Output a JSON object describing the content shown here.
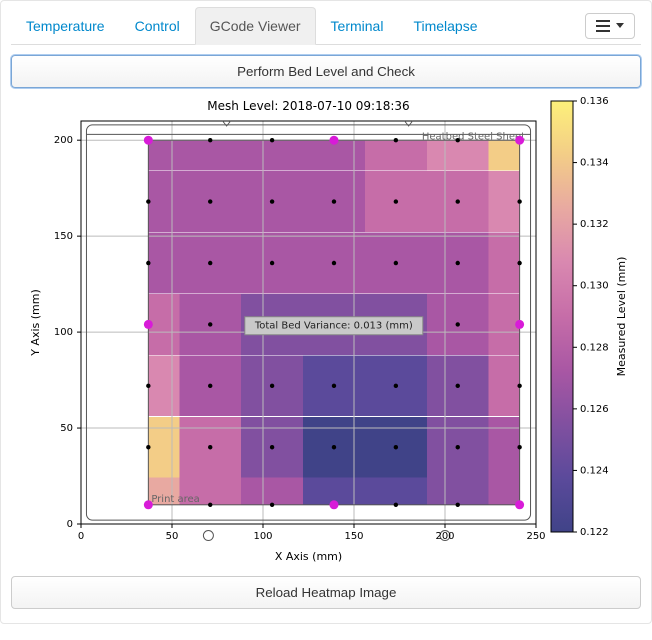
{
  "tabs": {
    "items": [
      {
        "label": "Temperature",
        "active": false
      },
      {
        "label": "Control",
        "active": false
      },
      {
        "label": "GCode Viewer",
        "active": true
      },
      {
        "label": "Terminal",
        "active": false
      },
      {
        "label": "Timelapse",
        "active": false
      }
    ]
  },
  "buttons": {
    "perform": "Perform Bed Level and Check",
    "reload": "Reload Heatmap Image"
  },
  "plot": {
    "title": "Mesh Level: 2018-07-10 09:18:36",
    "xlabel": "X Axis (mm)",
    "ylabel": "Y Axis (mm)",
    "cbarlabel": "Measured Level (mm)",
    "annot_sheet": "Heatbed Steel Sheet",
    "annot_print": "Print area",
    "variance": "Total Bed Variance: 0.013 (mm)",
    "x_ticks": [
      "0",
      "50",
      "100",
      "150",
      "200",
      "250"
    ],
    "y_ticks": [
      "0",
      "50",
      "100",
      "150",
      "200"
    ],
    "cbar_ticks": [
      "0.122",
      "0.124",
      "0.126",
      "0.128",
      "0.130",
      "0.132",
      "0.134",
      "0.136"
    ]
  },
  "chart_data": {
    "type": "heatmap",
    "title": "Mesh Level: 2018-07-10 09:18:36",
    "xlabel": "X Axis (mm)",
    "ylabel": "Y Axis (mm)",
    "zlabel": "Measured Level (mm)",
    "xlim": [
      0,
      250
    ],
    "ylim": [
      0,
      210
    ],
    "zlim": [
      0.122,
      0.136
    ],
    "colorbar_ticks": [
      0.122,
      0.124,
      0.126,
      0.128,
      0.13,
      0.132,
      0.134,
      0.136
    ],
    "variance_mm": 0.013,
    "probe_grid": {
      "x": [
        37,
        71,
        105,
        139,
        173,
        207,
        241
      ],
      "y": [
        10,
        40,
        72,
        104,
        136,
        168,
        200
      ]
    },
    "highlighted_points": [
      {
        "x": 37,
        "y": 10
      },
      {
        "x": 139,
        "y": 10
      },
      {
        "x": 241,
        "y": 10
      },
      {
        "x": 37,
        "y": 104
      },
      {
        "x": 139,
        "y": 104
      },
      {
        "x": 241,
        "y": 104
      },
      {
        "x": 37,
        "y": 200
      },
      {
        "x": 139,
        "y": 200
      },
      {
        "x": 241,
        "y": 200
      }
    ],
    "z_estimated": [
      [
        0.134,
        0.13,
        0.128,
        0.124,
        0.124,
        0.126,
        0.128
      ],
      [
        0.135,
        0.129,
        0.127,
        0.123,
        0.123,
        0.126,
        0.128
      ],
      [
        0.131,
        0.128,
        0.126,
        0.124,
        0.125,
        0.127,
        0.129
      ],
      [
        0.129,
        0.128,
        0.127,
        0.127,
        0.127,
        0.128,
        0.129
      ],
      [
        0.128,
        0.128,
        0.128,
        0.128,
        0.128,
        0.128,
        0.13
      ],
      [
        0.128,
        0.128,
        0.128,
        0.128,
        0.129,
        0.13,
        0.132
      ],
      [
        0.128,
        0.128,
        0.128,
        0.128,
        0.13,
        0.132,
        0.135
      ]
    ]
  }
}
